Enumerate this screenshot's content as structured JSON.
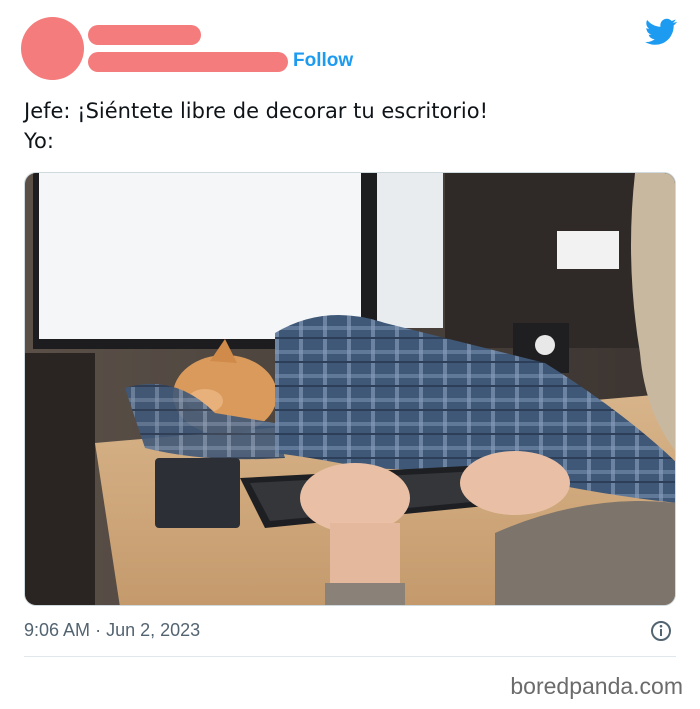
{
  "header": {
    "follow_label": "Follow"
  },
  "tweet": {
    "line1": "Jefe: ¡Siéntete libre de decorar tu escritorio!",
    "line2": "Yo:"
  },
  "footer": {
    "time": "9:06 AM",
    "separator": "·",
    "date": "Jun 2, 2023"
  },
  "watermark": "boredpanda.com",
  "colors": {
    "brand": "#1d9bf0",
    "redaction": "#f47c7c"
  },
  "icons": [
    "twitter-bird-icon",
    "info-icon"
  ]
}
